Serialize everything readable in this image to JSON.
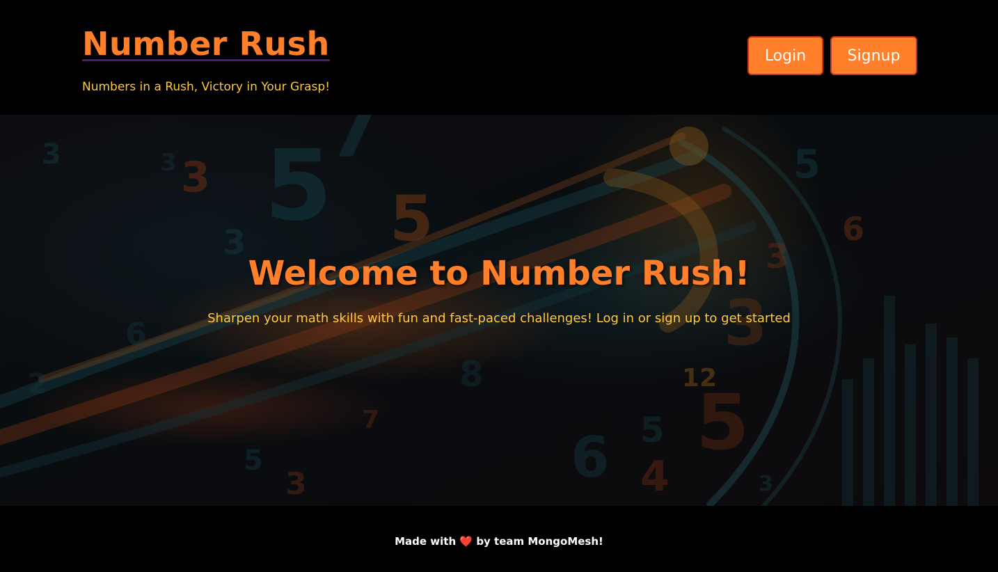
{
  "header": {
    "brand": "Number Rush",
    "tagline": "Numbers in a Rush, Victory in Your Grasp!",
    "login_label": "Login",
    "signup_label": "Signup"
  },
  "hero": {
    "title": "Welcome to Number Rush!",
    "subtitle": "Sharpen your math skills with fun and fast-paced challenges! Log in or sign up to get started"
  },
  "footer": {
    "prefix": "Made with",
    "heart": "❤️",
    "suffix": "by team MongoMesh!"
  },
  "colors": {
    "accent": "#ff7f2a",
    "tagline": "#ffc93c",
    "background": "#000000"
  },
  "icons": {
    "footer_heart": "heart-icon"
  }
}
